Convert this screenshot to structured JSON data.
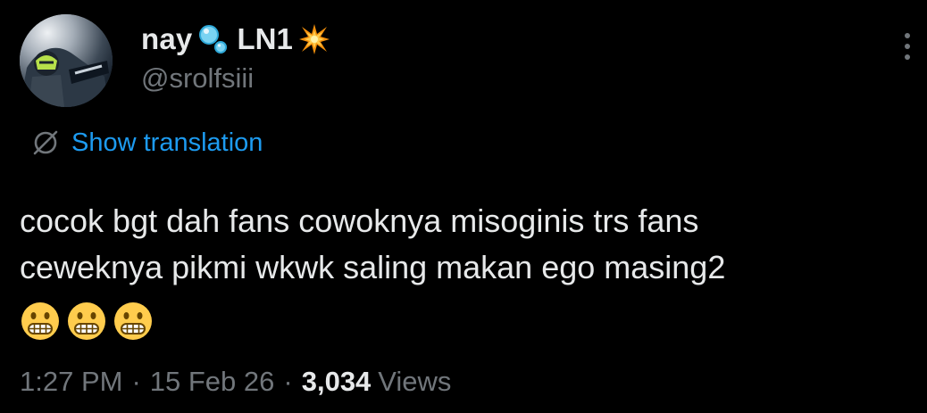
{
  "post": {
    "author": {
      "display_name": "nay",
      "display_name_suffix": "LN1",
      "handle": "@srolfsiii",
      "emoji_after_name": "bubbles",
      "emoji_after_suffix": "collision"
    },
    "translation": {
      "label": "Show translation",
      "icon": "globe-slash-icon"
    },
    "text": "cocok bgt dah fans cowoknya misoginis trs fans\nceweknya pikmi wkwk saling makan ego masing2",
    "emojis": [
      "grimacing-face",
      "grimacing-face",
      "grimacing-face"
    ],
    "meta": {
      "time": "1:27 PM",
      "separator": "·",
      "date": "15 Feb 26",
      "views_count": "3,034",
      "views_label": "Views"
    }
  },
  "colors": {
    "background": "#000000",
    "text_primary": "#e7e9ea",
    "text_secondary": "#71767b",
    "accent": "#1d9bf0"
  },
  "icons": {
    "more": "more-vertical-icon"
  }
}
